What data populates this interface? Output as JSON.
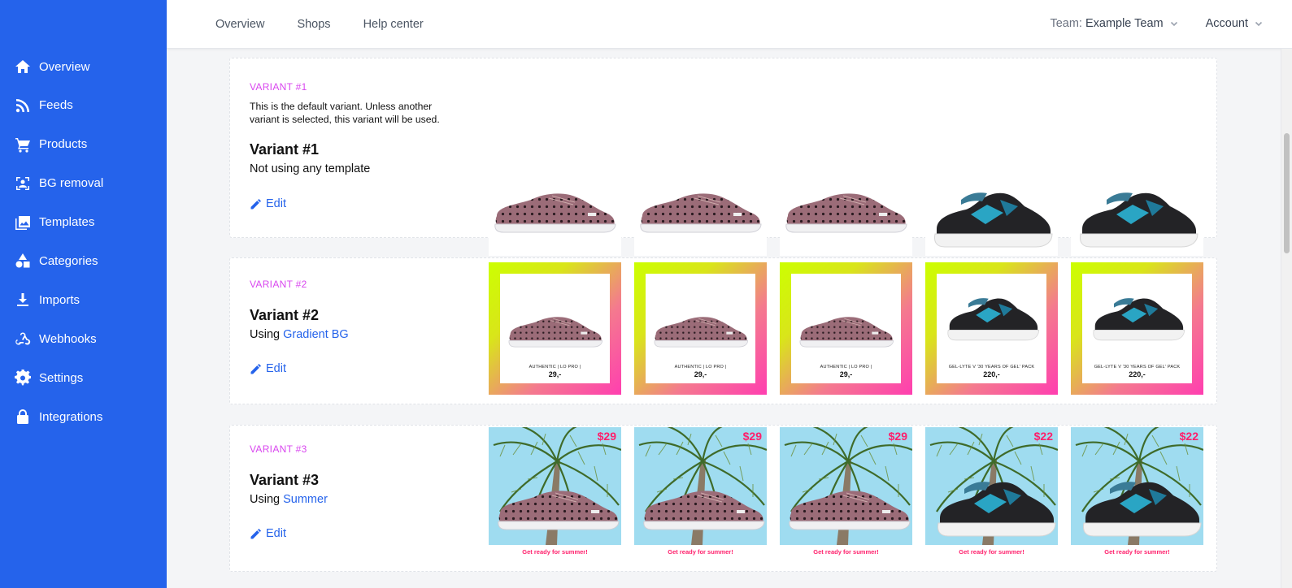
{
  "sidebar": {
    "items": [
      {
        "label": "Overview",
        "icon": "home-icon"
      },
      {
        "label": "Feeds",
        "icon": "rss-icon"
      },
      {
        "label": "Products",
        "icon": "cart-icon"
      },
      {
        "label": "BG removal",
        "icon": "bg-removal-icon"
      },
      {
        "label": "Templates",
        "icon": "image-icon"
      },
      {
        "label": "Categories",
        "icon": "shapes-icon"
      },
      {
        "label": "Imports",
        "icon": "download-icon"
      },
      {
        "label": "Webhooks",
        "icon": "webhook-icon"
      },
      {
        "label": "Settings",
        "icon": "gear-icon"
      },
      {
        "label": "Integrations",
        "icon": "lock-icon"
      }
    ]
  },
  "topnav": {
    "overview": "Overview",
    "shops": "Shops",
    "help": "Help center",
    "team_label": "Team:",
    "team_value": "Example Team",
    "account": "Account"
  },
  "colors": {
    "primary": "#2563eb",
    "variant_tag": "#d946ef",
    "sale_pink": "#ff1f6b"
  },
  "variants": [
    {
      "tag": "VARIANT #1",
      "description": "This is the default variant. Unless another variant is selected, this variant will be used.",
      "title": "Variant #1",
      "subtitle": "Not using any template",
      "edit": "Edit",
      "products": [
        "pink-sneaker",
        "pink-sneaker",
        "pink-sneaker",
        "black-runner",
        "black-runner"
      ]
    },
    {
      "tag": "VARIANT #2",
      "title": "Variant #2",
      "subtitle_prefix": "Using",
      "template": "Gradient BG",
      "edit": "Edit",
      "products": [
        {
          "name": "AUTHENTIC | LO PRO |",
          "price": "29,-"
        },
        {
          "name": "AUTHENTIC | LO PRO |",
          "price": "29,-"
        },
        {
          "name": "AUTHENTIC | LO PRO |",
          "price": "29,-"
        },
        {
          "name": "GEL-LYTE V '30 YEARS OF GEL' PACK",
          "price": "220,-"
        },
        {
          "name": "GEL-LYTE V '30 YEARS OF GEL' PACK",
          "price": "220,-"
        }
      ]
    },
    {
      "tag": "VARIANT #3",
      "title": "Variant #3",
      "subtitle_prefix": "Using",
      "template": "Summer",
      "edit": "Edit",
      "products": [
        {
          "price": "$29",
          "caption": "Get ready for summer!"
        },
        {
          "price": "$29",
          "caption": "Get ready for summer!"
        },
        {
          "price": "$29",
          "caption": "Get ready for summer!"
        },
        {
          "price": "$22",
          "caption": "Get ready for summer!"
        },
        {
          "price": "$22",
          "caption": "Get ready for summer!"
        }
      ]
    }
  ]
}
